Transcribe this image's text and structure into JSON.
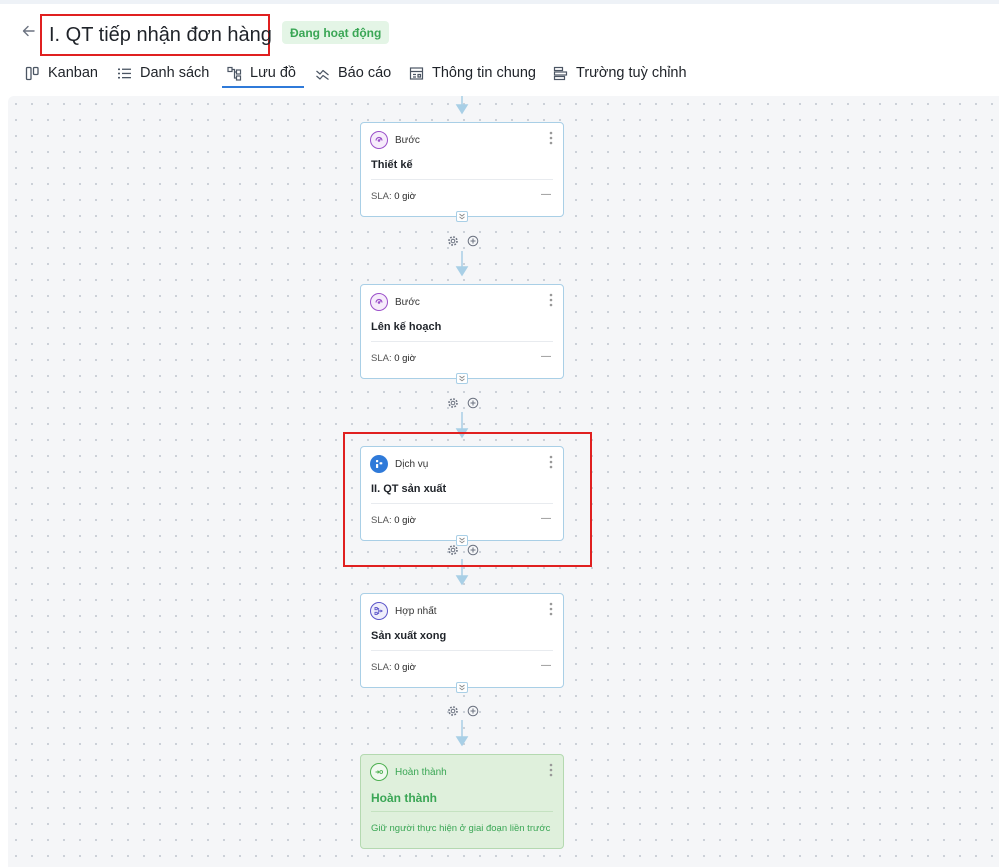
{
  "header": {
    "title": "I. QT tiếp nhận đơn hàng",
    "status_badge": "Đang hoạt động"
  },
  "tabs": [
    {
      "label": "Kanban",
      "icon": "kanban-icon",
      "active": false
    },
    {
      "label": "Danh sách",
      "icon": "list-icon",
      "active": false
    },
    {
      "label": "Lưu đồ",
      "icon": "flowchart-icon",
      "active": true
    },
    {
      "label": "Báo cáo",
      "icon": "report-icon",
      "active": false
    },
    {
      "label": "Thông tin chung",
      "icon": "info-icon",
      "active": false
    },
    {
      "label": "Trường tuỳ chỉnh",
      "icon": "custom-fields-icon",
      "active": false
    }
  ],
  "nodes": [
    {
      "type_label": "Bước",
      "name": "Thiết kế",
      "sla_label": "SLA:",
      "sla_value": "0 giờ",
      "trailing": "—",
      "icon": "step-icon"
    },
    {
      "type_label": "Bước",
      "name": "Lên kế hoạch",
      "sla_label": "SLA:",
      "sla_value": "0 giờ",
      "trailing": "—",
      "icon": "step-icon"
    },
    {
      "type_label": "Dịch vụ",
      "name": "II. QT sản xuất",
      "sla_label": "SLA:",
      "sla_value": "0 giờ",
      "trailing": "—",
      "icon": "service-icon"
    },
    {
      "type_label": "Hợp nhất",
      "name": "Sản xuất xong",
      "sla_label": "SLA:",
      "sla_value": "0 giờ",
      "trailing": "—",
      "icon": "merge-icon"
    },
    {
      "type_label": "Hoàn thành",
      "name": "Hoàn thành",
      "note": "Giữ người thực hiện ở giai đoạn liền trước",
      "icon": "complete-icon"
    }
  ],
  "colors": {
    "accent": "#2f7ad9",
    "badge_bg": "#e4f5e6",
    "badge_text": "#3aa655",
    "highlight": "#e02020",
    "card_border": "#a9cfe6",
    "done_bg": "#dff0dc",
    "connector": "#a8cfe6"
  }
}
